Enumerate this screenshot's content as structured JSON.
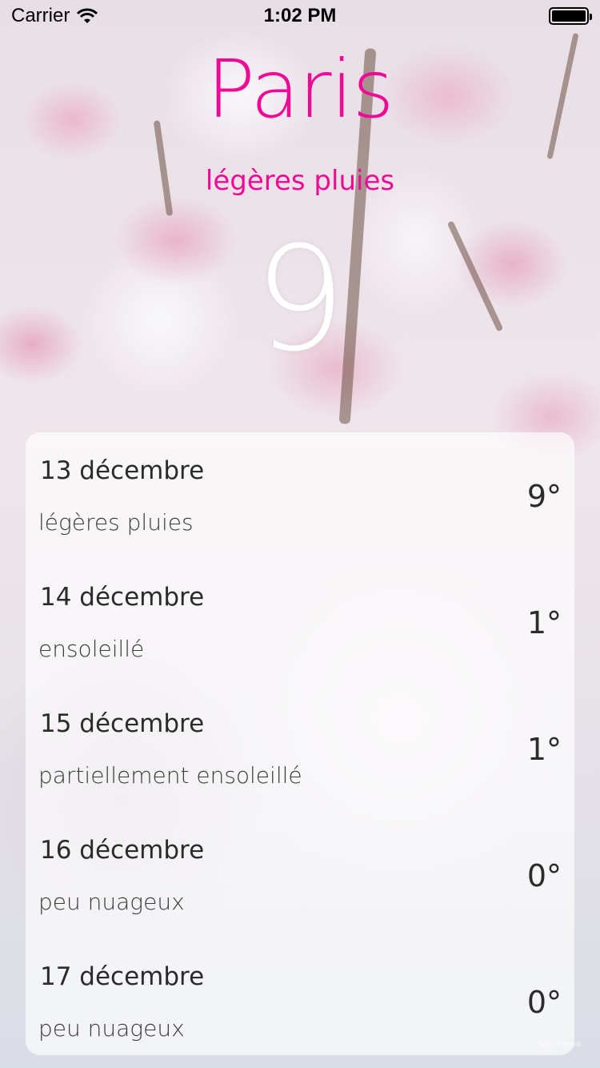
{
  "status_bar": {
    "carrier": "Carrier",
    "time": "1:02 PM",
    "wifi_icon": "wifi-icon",
    "battery_icon": "battery-icon",
    "battery_level": 1.0
  },
  "header": {
    "city": "Paris",
    "condition": "légères pluies",
    "current_temperature": "9"
  },
  "forecast": [
    {
      "date": "13 décembre",
      "description": "légères pluies",
      "temperature": "9°"
    },
    {
      "date": "14 décembre",
      "description": "ensoleillé",
      "temperature": "1°"
    },
    {
      "date": "15 décembre",
      "description": "partiellement ensoleillé",
      "temperature": "1°"
    },
    {
      "date": "16 décembre",
      "description": "peu nuageux",
      "temperature": "0°"
    },
    {
      "date": "17 décembre",
      "description": "peu nuageux",
      "temperature": "0°"
    }
  ],
  "watermark": "Sky - Genya",
  "colors": {
    "accent": "#ef0a96",
    "temperature": "#ffffff",
    "text_dark": "#2b2b2b"
  }
}
